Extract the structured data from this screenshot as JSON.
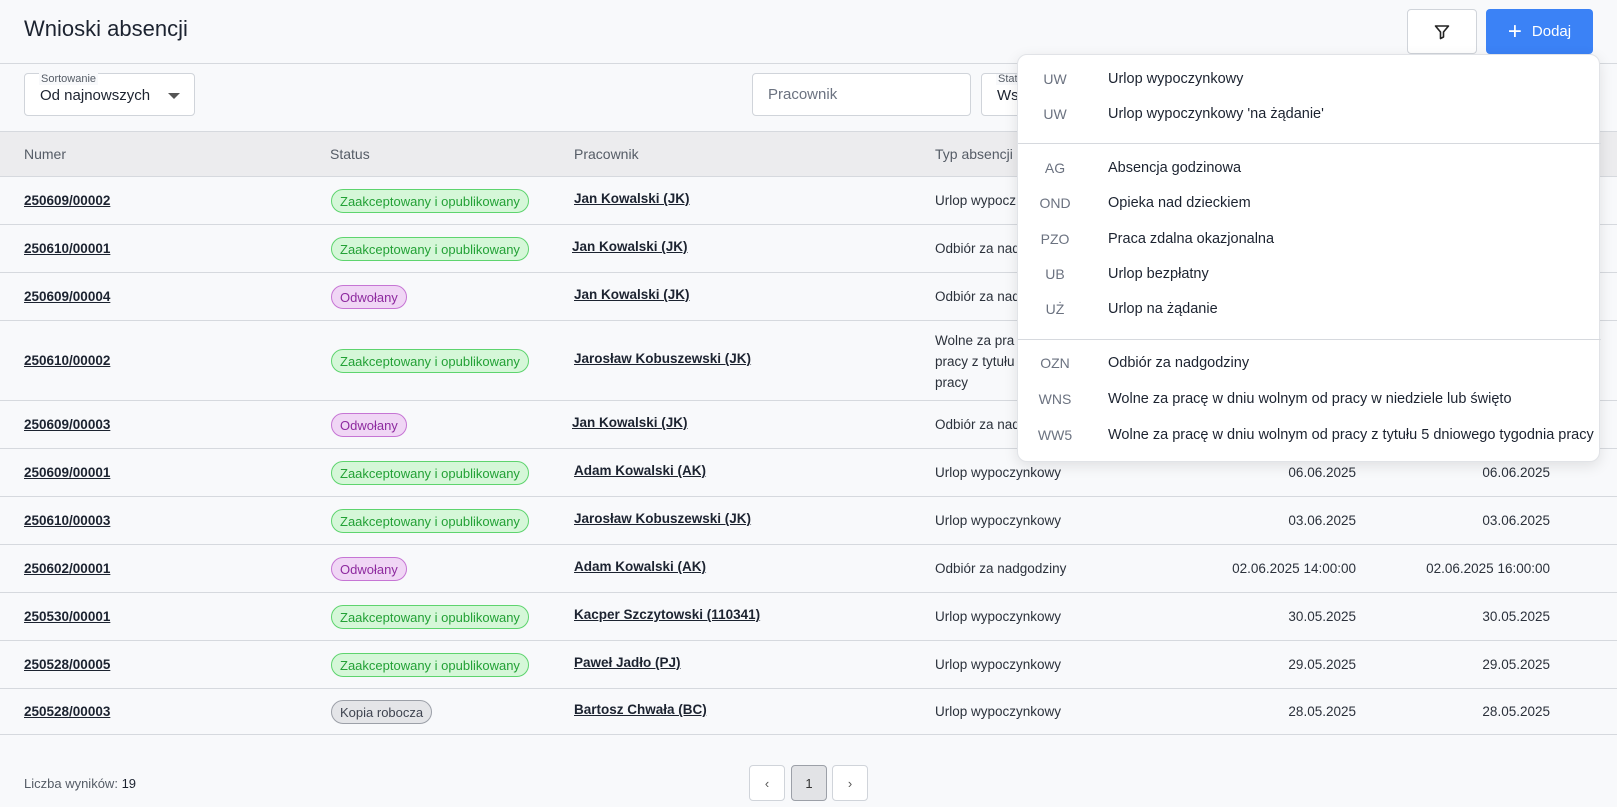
{
  "header": {
    "title": "Wnioski absencji",
    "add_label": "Dodaj"
  },
  "filters": {
    "sort_label": "Sortowanie",
    "sort_value": "Od najnowszych",
    "employee_placeholder": "Pracownik",
    "status_label": "Stat",
    "status_value": "Ws"
  },
  "table": {
    "headers": {
      "numer": "Numer",
      "status": "Status",
      "pracownik": "Pracownik",
      "typ": "Typ absencji"
    },
    "rows": [
      {
        "numer": "250609/00002",
        "status": "Zaakceptowany i opublikowany",
        "status_kind": "accepted",
        "pracownik": "Jan Kowalski (JK)",
        "typ": "Urlop wypocz",
        "od": "",
        "do": ""
      },
      {
        "numer": "250610/00001",
        "status": "Zaakceptowany i opublikowany",
        "status_kind": "accepted",
        "pracownik": "Jan Kowalski (JK)",
        "typ": "Odbiór za nad",
        "od": "",
        "do": ""
      },
      {
        "numer": "250609/00004",
        "status": "Odwołany",
        "status_kind": "cancelled",
        "pracownik": "Jan Kowalski (JK)",
        "typ": "Odbiór za nad",
        "od": "",
        "do": ""
      },
      {
        "numer": "250610/00002",
        "status": "Zaakceptowany i opublikowany",
        "status_kind": "accepted",
        "pracownik": "Jarosław Kobuszewski (JK)",
        "typ_lines": [
          "Wolne za pra",
          "pracy z tytułu",
          "pracy"
        ],
        "od": "",
        "do": ""
      },
      {
        "numer": "250609/00003",
        "status": "Odwołany",
        "status_kind": "cancelled",
        "pracownik": "Jan Kowalski (JK)",
        "typ": "Odbiór za nad",
        "od": "",
        "do": ""
      },
      {
        "numer": "250609/00001",
        "status": "Zaakceptowany i opublikowany",
        "status_kind": "accepted",
        "pracownik": "Adam Kowalski (AK)",
        "typ": "Urlop wypoczynkowy",
        "od": "06.06.2025",
        "do": "06.06.2025"
      },
      {
        "numer": "250610/00003",
        "status": "Zaakceptowany i opublikowany",
        "status_kind": "accepted",
        "pracownik": "Jarosław Kobuszewski (JK)",
        "typ": "Urlop wypoczynkowy",
        "od": "03.06.2025",
        "do": "03.06.2025"
      },
      {
        "numer": "250602/00001",
        "status": "Odwołany",
        "status_kind": "cancelled",
        "pracownik": "Adam Kowalski (AK)",
        "typ": "Odbiór za nadgodziny",
        "od": "02.06.2025 14:00:00",
        "do": "02.06.2025 16:00:00"
      },
      {
        "numer": "250530/00001",
        "status": "Zaakceptowany i opublikowany",
        "status_kind": "accepted",
        "pracownik": "Kacper Szczytowski (110341)",
        "typ": "Urlop wypoczynkowy",
        "od": "30.05.2025",
        "do": "30.05.2025"
      },
      {
        "numer": "250528/00005",
        "status": "Zaakceptowany i opublikowany",
        "status_kind": "accepted",
        "pracownik": "Paweł Jadło (PJ)",
        "typ": "Urlop wypoczynkowy",
        "od": "29.05.2025",
        "do": "29.05.2025"
      },
      {
        "numer": "250528/00003",
        "status": "Kopia robocza",
        "status_kind": "draft",
        "pracownik": "Bartosz Chwała (BC)",
        "typ": "Urlop wypoczynkowy",
        "od": "28.05.2025",
        "do": "28.05.2025"
      }
    ]
  },
  "footer": {
    "results_label": "Liczba wyników:",
    "results_count": "19",
    "page": "1"
  },
  "dropdown": {
    "groups": [
      [
        {
          "code": "UW",
          "label": "Urlop wypoczynkowy"
        },
        {
          "code": "UW",
          "label": "Urlop wypoczynkowy 'na żądanie'"
        }
      ],
      [
        {
          "code": "AG",
          "label": "Absencja godzinowa"
        },
        {
          "code": "OND",
          "label": "Opieka nad dzieckiem"
        },
        {
          "code": "PZO",
          "label": "Praca zdalna okazjonalna"
        },
        {
          "code": "UB",
          "label": "Urlop bezpłatny"
        },
        {
          "code": "UŻ",
          "label": "Urlop na żądanie"
        }
      ],
      [
        {
          "code": "OZN",
          "label": "Odbiór za nadgodziny"
        },
        {
          "code": "WNS",
          "label": "Wolne za pracę w dniu wolnym od pracy w niedziele lub święto"
        },
        {
          "code": "WW5",
          "label": "Wolne za pracę w dniu wolnym od pracy z tytułu 5 dniowego tygodnia pracy"
        }
      ]
    ]
  },
  "colors": {
    "accent": "#3b82f6",
    "accepted_bg": "#d5f7d8",
    "cancelled_bg": "#f0d6f5",
    "draft_bg": "#e4e5e8"
  }
}
